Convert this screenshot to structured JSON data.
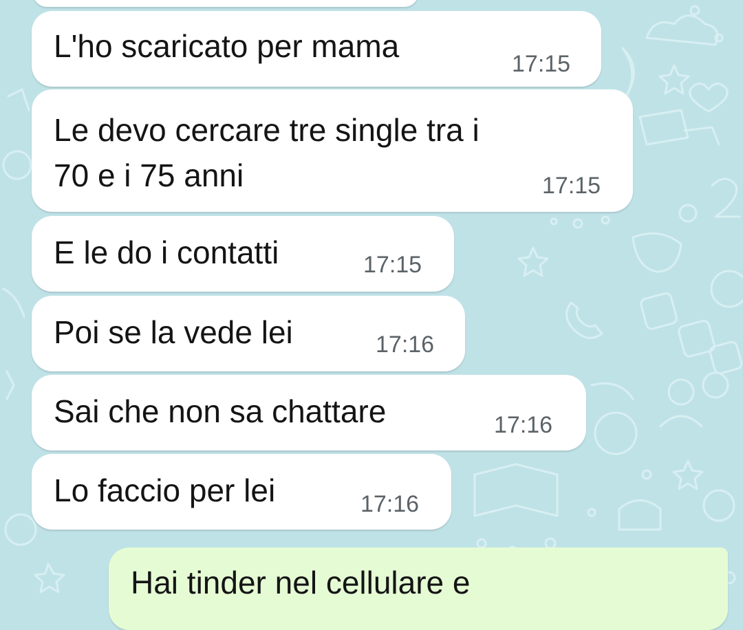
{
  "chat": {
    "background_color": "#bfe2e7",
    "incoming_bubble_color": "#ffffff",
    "outgoing_bubble_color": "#e5fbd4",
    "messages": [
      {
        "direction": "incoming",
        "text": "L'ho scaricato per mama",
        "time": "17:15"
      },
      {
        "direction": "incoming",
        "text_line1": "Le devo cercare tre single tra i",
        "text_line2": "70 e i 75 anni",
        "time": "17:15"
      },
      {
        "direction": "incoming",
        "text": "E le do i contatti",
        "time": "17:15"
      },
      {
        "direction": "incoming",
        "text": "Poi se la vede lei",
        "time": "17:16"
      },
      {
        "direction": "incoming",
        "text": "Sai che non sa chattare",
        "time": "17:16"
      },
      {
        "direction": "incoming",
        "text": "Lo faccio per lei",
        "time": "17:16"
      },
      {
        "direction": "outgoing",
        "text": "Hai tinder nel cellulare e"
      }
    ]
  }
}
